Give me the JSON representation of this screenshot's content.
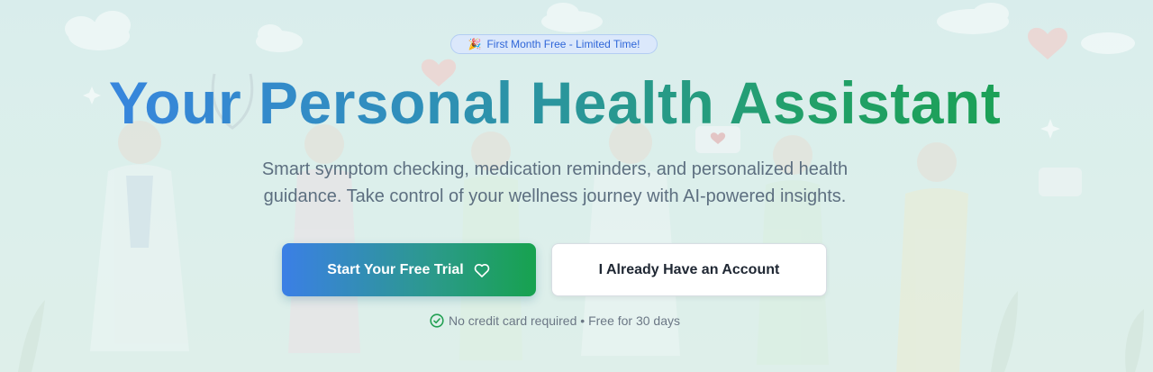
{
  "hero": {
    "badge": {
      "emoji": "🎉",
      "text": "First Month Free - Limited Time!"
    },
    "title": "Your Personal Health Assistant",
    "subtitle": "Smart symptom checking, medication reminders, and personalized health guidance. Take control of your wellness journey with AI-powered insights.",
    "primary_button": {
      "label": "Start Your Free Trial",
      "icon": "heart-icon"
    },
    "secondary_button": {
      "label": "I Already Have an Account"
    },
    "note": {
      "icon": "check-circle-icon",
      "text": "No credit card required • Free for 30 days"
    }
  },
  "colors": {
    "gradient_start": "#3a82ea",
    "gradient_end": "#18a14b",
    "badge_text": "#2f66d8",
    "check_green": "#22a053"
  }
}
